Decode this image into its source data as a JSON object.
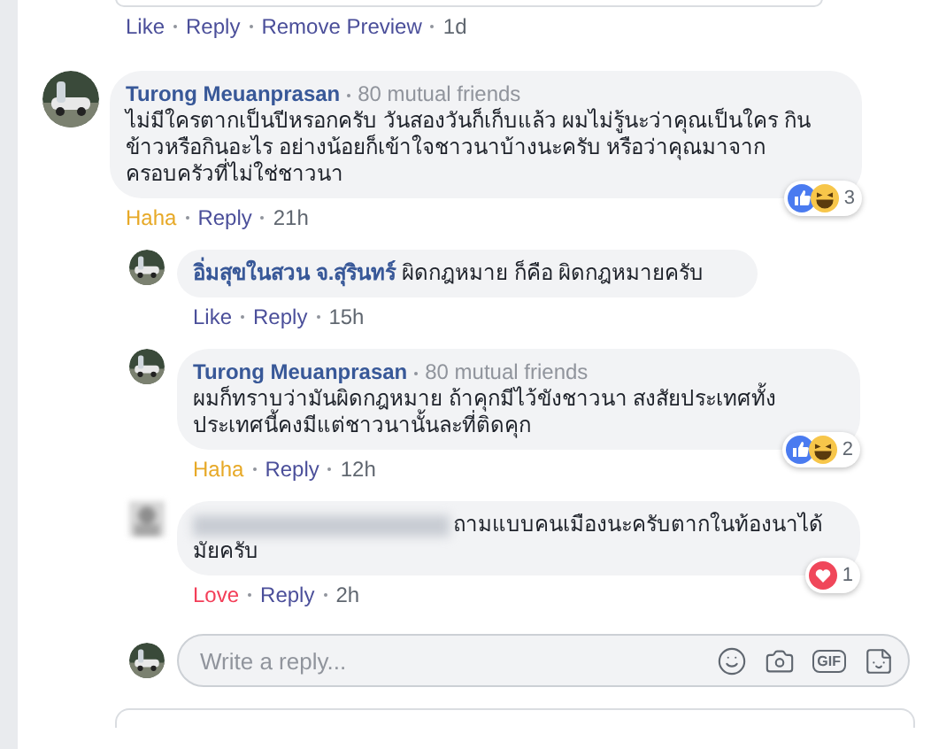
{
  "top_actions": [
    {
      "label": "Like",
      "kind": "link"
    },
    {
      "label": "Reply",
      "kind": "link"
    },
    {
      "label": "Remove Preview",
      "kind": "link"
    },
    {
      "label": "1d",
      "kind": "time"
    }
  ],
  "comments": [
    {
      "kind": "top",
      "author": {
        "name": "Turong Meuanprasan",
        "mutual": "80 mutual friends"
      },
      "text": "ไม่มีใครตากเป็นปีหรอกครับ วันสองวันก็เก็บแล้ว ผมไม่รู้นะว่าคุณเป็นใคร กินข้าวหรือกินอะไร อย่างน้อยก็เข้าใจชาวนาบ้างนะครับ หรือว่าคุณมาจากครอบครัวที่ไม่ใช่ชาวนา",
      "actions": [
        {
          "label": "Haha",
          "kind": "haha"
        },
        {
          "label": "Reply",
          "kind": "link"
        },
        {
          "label": "21h",
          "kind": "time"
        }
      ],
      "reactions": [
        {
          "kind": "like"
        },
        {
          "kind": "haha"
        }
      ],
      "reaction_count": "3"
    },
    {
      "kind": "reply",
      "inline_author": "อิ่มสุขในสวน จ.สุรินทร์",
      "text": "ผิดกฎหมาย ก็คือ ผิดกฎหมายครับ",
      "actions": [
        {
          "label": "Like",
          "kind": "link"
        },
        {
          "label": "Reply",
          "kind": "link"
        },
        {
          "label": "15h",
          "kind": "time"
        }
      ]
    },
    {
      "kind": "reply",
      "author": {
        "name": "Turong Meuanprasan",
        "mutual": "80 mutual friends"
      },
      "text": "ผมก็ทราบว่ามันผิดกฎหมาย ถ้าคุกมีไว้ขังชาวนา สงสัยประเทศทั้งประเทศนี้คงมีแต่ชาวนานั้นละที่ติดคุก",
      "actions": [
        {
          "label": "Haha",
          "kind": "haha"
        },
        {
          "label": "Reply",
          "kind": "link"
        },
        {
          "label": "12h",
          "kind": "time"
        }
      ],
      "reactions": [
        {
          "kind": "like"
        },
        {
          "kind": "haha"
        }
      ],
      "reaction_count": "2"
    },
    {
      "kind": "reply",
      "author_hidden": true,
      "text": "ถามแบบคนเมืองนะครับตากในท้องนาได้มัยครับ",
      "actions": [
        {
          "label": "Love",
          "kind": "love"
        },
        {
          "label": "Reply",
          "kind": "link"
        },
        {
          "label": "2h",
          "kind": "time"
        }
      ],
      "reactions": [
        {
          "kind": "love"
        }
      ],
      "reaction_count": "1"
    }
  ],
  "reply_box": {
    "placeholder": "Write a reply...",
    "gif_label": "GIF"
  }
}
